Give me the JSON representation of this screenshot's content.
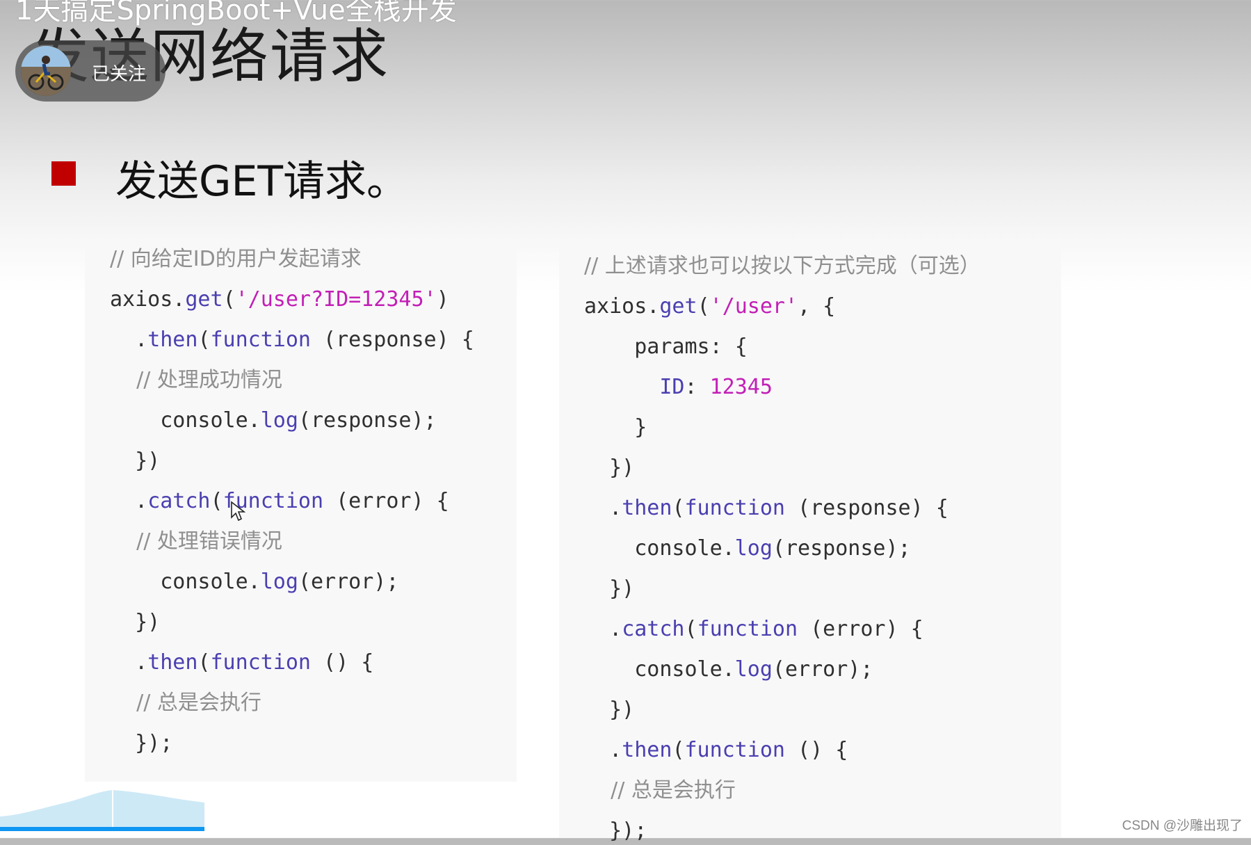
{
  "video": {
    "title": "1天搞定SpringBoot+Vue全栈开发",
    "follow_label": "已关注"
  },
  "slide": {
    "title": "发送网络请求",
    "bullet": "发送GET请求。"
  },
  "code_left": [
    [
      {
        "t": "comment",
        "v": "// 向给定ID的用户发起请求"
      }
    ],
    [
      {
        "t": "plain",
        "v": "axios."
      },
      {
        "t": "method",
        "v": "get"
      },
      {
        "t": "plain",
        "v": "("
      },
      {
        "t": "str",
        "v": "'/user?ID=12345'"
      },
      {
        "t": "plain",
        "v": ")"
      }
    ],
    [
      {
        "t": "plain",
        "v": "  ."
      },
      {
        "t": "method",
        "v": "then"
      },
      {
        "t": "plain",
        "v": "("
      },
      {
        "t": "kw",
        "v": "function"
      },
      {
        "t": "plain",
        "v": " (response) {"
      }
    ],
    [
      {
        "t": "comment",
        "v": "    // 处理成功情况"
      }
    ],
    [
      {
        "t": "plain",
        "v": "    console."
      },
      {
        "t": "method",
        "v": "log"
      },
      {
        "t": "plain",
        "v": "(response);"
      }
    ],
    [
      {
        "t": "plain",
        "v": "  })"
      }
    ],
    [
      {
        "t": "plain",
        "v": "  ."
      },
      {
        "t": "method",
        "v": "catch"
      },
      {
        "t": "plain",
        "v": "("
      },
      {
        "t": "kw",
        "v": "function"
      },
      {
        "t": "plain",
        "v": " (error) {"
      }
    ],
    [
      {
        "t": "comment",
        "v": "    // 处理错误情况"
      }
    ],
    [
      {
        "t": "plain",
        "v": "    console."
      },
      {
        "t": "method",
        "v": "log"
      },
      {
        "t": "plain",
        "v": "(error);"
      }
    ],
    [
      {
        "t": "plain",
        "v": "  })"
      }
    ],
    [
      {
        "t": "plain",
        "v": "  ."
      },
      {
        "t": "method",
        "v": "then"
      },
      {
        "t": "plain",
        "v": "("
      },
      {
        "t": "kw",
        "v": "function"
      },
      {
        "t": "plain",
        "v": " () {"
      }
    ],
    [
      {
        "t": "comment",
        "v": "    // 总是会执行"
      }
    ],
    [
      {
        "t": "plain",
        "v": "  });"
      }
    ]
  ],
  "code_right": [
    [
      {
        "t": "comment",
        "v": "// 上述请求也可以按以下方式完成（可选）"
      }
    ],
    [
      {
        "t": "plain",
        "v": "axios."
      },
      {
        "t": "method",
        "v": "get"
      },
      {
        "t": "plain",
        "v": "("
      },
      {
        "t": "str",
        "v": "'/user'"
      },
      {
        "t": "plain",
        "v": ", {"
      }
    ],
    [
      {
        "t": "plain",
        "v": "    params: {"
      }
    ],
    [
      {
        "t": "key",
        "v": "      ID"
      },
      {
        "t": "plain",
        "v": ": "
      },
      {
        "t": "num",
        "v": "12345"
      }
    ],
    [
      {
        "t": "plain",
        "v": "    }"
      }
    ],
    [
      {
        "t": "plain",
        "v": "  })"
      }
    ],
    [
      {
        "t": "plain",
        "v": "  ."
      },
      {
        "t": "method",
        "v": "then"
      },
      {
        "t": "plain",
        "v": "("
      },
      {
        "t": "kw",
        "v": "function"
      },
      {
        "t": "plain",
        "v": " (response) {"
      }
    ],
    [
      {
        "t": "plain",
        "v": "    console."
      },
      {
        "t": "method",
        "v": "log"
      },
      {
        "t": "plain",
        "v": "(response);"
      }
    ],
    [
      {
        "t": "plain",
        "v": "  })"
      }
    ],
    [
      {
        "t": "plain",
        "v": "  ."
      },
      {
        "t": "method",
        "v": "catch"
      },
      {
        "t": "plain",
        "v": "("
      },
      {
        "t": "kw",
        "v": "function"
      },
      {
        "t": "plain",
        "v": " (error) {"
      }
    ],
    [
      {
        "t": "plain",
        "v": "    console."
      },
      {
        "t": "method",
        "v": "log"
      },
      {
        "t": "plain",
        "v": "(error);"
      }
    ],
    [
      {
        "t": "plain",
        "v": "  })"
      }
    ],
    [
      {
        "t": "plain",
        "v": "  ."
      },
      {
        "t": "method",
        "v": "then"
      },
      {
        "t": "plain",
        "v": "("
      },
      {
        "t": "kw",
        "v": "function"
      },
      {
        "t": "plain",
        "v": " () {"
      }
    ],
    [
      {
        "t": "comment",
        "v": "    // 总是会执行"
      }
    ],
    [
      {
        "t": "plain",
        "v": "  });"
      }
    ]
  ],
  "watermark": "CSDN @沙雕出现了",
  "colors": {
    "bullet": "#c00000",
    "progress": "#0d96f2",
    "string": "#c21fb6",
    "keyword": "#4a3fb0",
    "comment": "#8f8f8f"
  },
  "icons": [
    "avatar",
    "mouse-cursor-icon"
  ]
}
